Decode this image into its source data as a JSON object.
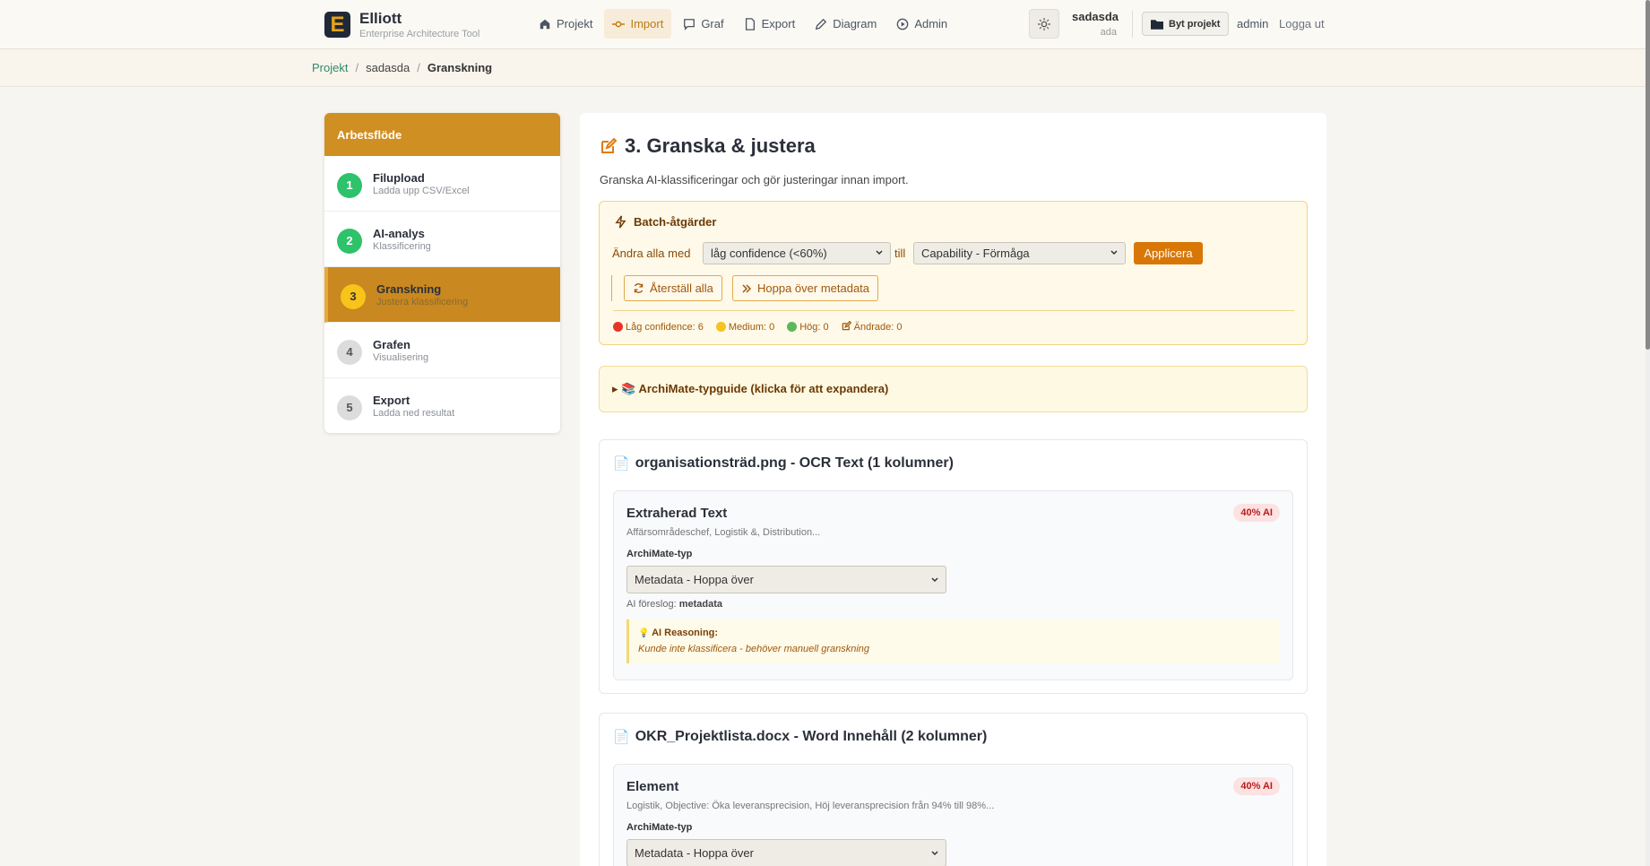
{
  "brand": {
    "name": "Elliott",
    "subtitle": "Enterprise Architecture Tool",
    "logo_letter": "E"
  },
  "nav": [
    {
      "label": "Projekt",
      "icon": "home-icon"
    },
    {
      "label": "Import",
      "icon": "commit-icon",
      "active": true
    },
    {
      "label": "Graf",
      "icon": "chat-icon"
    },
    {
      "label": "Export",
      "icon": "file-icon"
    },
    {
      "label": "Diagram",
      "icon": "pencil-icon"
    },
    {
      "label": "Admin",
      "icon": "play-circle-icon"
    }
  ],
  "user": {
    "project": "sadasda",
    "name": "ada",
    "switch_label": "Byt projekt",
    "admin_label": "admin",
    "logout_label": "Logga ut"
  },
  "breadcrumb": {
    "root": "Projekt",
    "project": "sadasda",
    "current": "Granskning"
  },
  "workflow": {
    "title": "Arbetsflöde",
    "steps": [
      {
        "num": "1",
        "title": "Filupload",
        "subtitle": "Ladda upp CSV/Excel",
        "status": "done"
      },
      {
        "num": "2",
        "title": "AI-analys",
        "subtitle": "Klassificering",
        "status": "done"
      },
      {
        "num": "3",
        "title": "Granskning",
        "subtitle": "Justera klassificering",
        "status": "current"
      },
      {
        "num": "4",
        "title": "Grafen",
        "subtitle": "Visualisering",
        "status": "todo"
      },
      {
        "num": "5",
        "title": "Export",
        "subtitle": "Ladda ned resultat",
        "status": "todo"
      }
    ]
  },
  "main": {
    "title": "3. Granska & justera",
    "description": "Granska AI-klassificeringar och gör justeringar innan import.",
    "batch": {
      "title": "Batch-åtgärder",
      "change_all_label": "Ändra alla med",
      "filter_value": "låg confidence (<60%)",
      "to_label": "till",
      "target_value": "Capability - Förmåga",
      "apply_label": "Applicera",
      "reset_label": "Återställ alla",
      "skip_label": "Hoppa över metadata",
      "stats": {
        "low": "Låg confidence: 6",
        "medium": "Medium: 0",
        "high": "Hög: 0",
        "changed": "Ändrade: 0"
      }
    },
    "guide_label": "▸ 📚 ArchiMate-typguide (klicka för att expandera)",
    "files": [
      {
        "title": "organisationsträd.png - OCR Text (1 kolumner)",
        "item": {
          "title": "Extraherad Text",
          "badge": "40% AI",
          "preview": "Affärsområdeschef, Logistik &, Distribution...",
          "type_label": "ArchiMate-typ",
          "type_value": "Metadata - Hoppa över",
          "suggest_label": "AI föreslog:",
          "suggest_value": "metadata",
          "reason_title": "AI Reasoning:",
          "reason_text": "Kunde inte klassificera - behöver manuell granskning"
        }
      },
      {
        "title": "OKR_Projektlista.docx - Word Innehåll (2 kolumner)",
        "item": {
          "title": "Element",
          "badge": "40% AI",
          "preview": "Logistik, Objective: Öka leveransprecision, Höj leveransprecision från 94% till 98%...",
          "type_label": "ArchiMate-typ",
          "type_value": "Metadata - Hoppa över"
        }
      }
    ]
  },
  "colors": {
    "accent": "#d08f22",
    "primary_btn": "#d97706",
    "done": "#2ec26b",
    "current": "#f8c419"
  }
}
